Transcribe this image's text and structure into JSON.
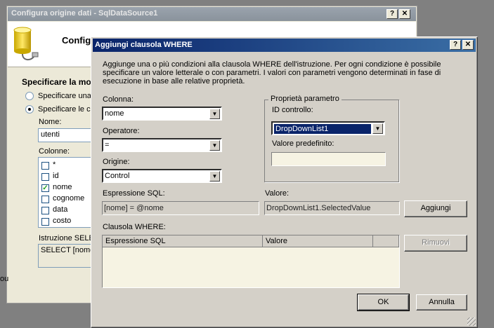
{
  "background_window": {
    "title": "Configura origine dati - SqlDataSource1",
    "header_title": "Configu",
    "heading": "Specificare la mo",
    "radio_options": [
      "Specificare una",
      "Specificare le co"
    ],
    "name_label": "Nome:",
    "name_value": "utenti",
    "columns_label": "Colonne:",
    "columns": [
      {
        "label": "*",
        "checked": false
      },
      {
        "label": "id",
        "checked": false
      },
      {
        "label": "nome",
        "checked": true
      },
      {
        "label": "cognome",
        "checked": false
      },
      {
        "label": "data",
        "checked": false
      },
      {
        "label": "costo",
        "checked": false
      }
    ],
    "statement_label": "Istruzione SELE",
    "statement_value": "SELECT [nome",
    "help_btn": "?",
    "close_btn": "✕",
    "left_edge_text": "ou"
  },
  "dialog": {
    "title": "Aggiungi clausola WHERE",
    "help_btn": "?",
    "close_btn": "✕",
    "description": "Aggiunge una o più condizioni alla clausola WHERE dell'istruzione. Per ogni condizione è possibile specificare un valore letterale o con parametri. I valori con parametri vengono determinati in fase di esecuzione in base alle relative proprietà.",
    "column_label": "Colonna:",
    "column_value": "nome",
    "operator_label": "Operatore:",
    "operator_value": "=",
    "source_label": "Origine:",
    "source_value": "Control",
    "param_group_title": "Proprietà parametro",
    "control_id_label": "ID controllo:",
    "control_id_value": "DropDownList1",
    "default_value_label": "Valore predefinito:",
    "default_value_value": "",
    "sql_expression_label": "Espressione SQL:",
    "sql_expression_value": "[nome] = @nome",
    "value_label": "Valore:",
    "value_value": "DropDownList1.SelectedValue",
    "add_button": "Aggiungi",
    "where_label": "Clausola WHERE:",
    "grid_headers": [
      "Espressione SQL",
      "Valore"
    ],
    "remove_button": "Rimuovi",
    "ok_button": "OK",
    "cancel_button": "Annulla"
  },
  "colors": {
    "active_title": "#0a246a",
    "selected_item": "#0a246a",
    "inactive_title": "#8a939c"
  }
}
